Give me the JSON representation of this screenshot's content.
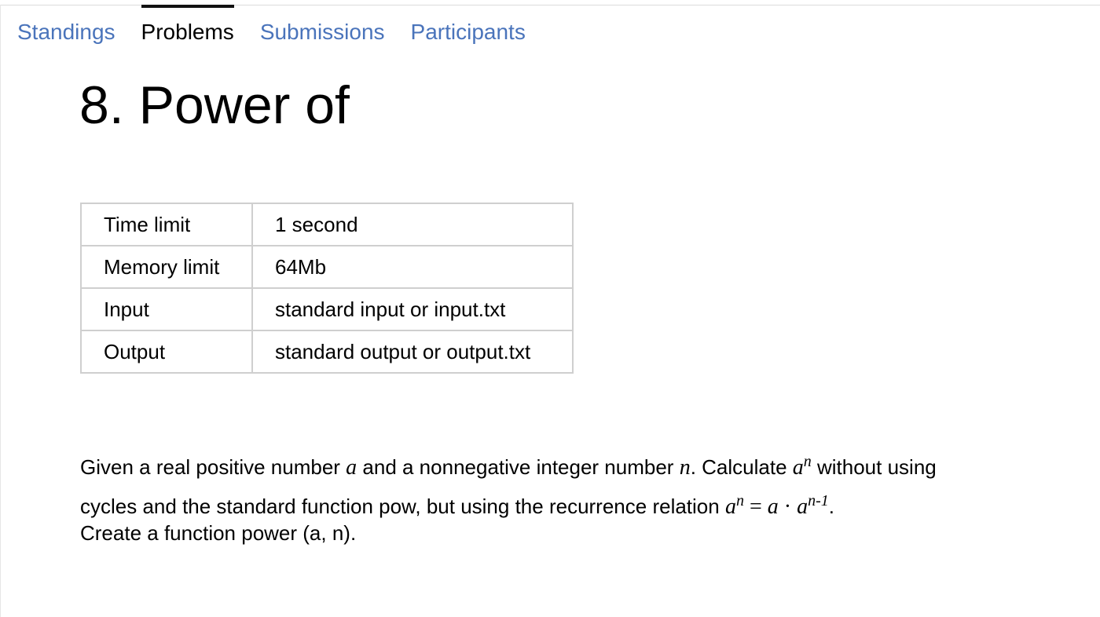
{
  "tabs": [
    {
      "label": "Standings",
      "active": false
    },
    {
      "label": "Problems",
      "active": true
    },
    {
      "label": "Submissions",
      "active": false
    },
    {
      "label": "Participants",
      "active": false
    }
  ],
  "problem": {
    "title": "8. Power of",
    "limits": [
      {
        "key": "Time limit",
        "value": "1 second"
      },
      {
        "key": "Memory limit",
        "value": "64Mb"
      },
      {
        "key": "Input",
        "value": "standard input or input.txt"
      },
      {
        "key": "Output",
        "value": "standard output or output.txt"
      }
    ],
    "statement": {
      "t1": "Given a real positive number ",
      "var_a": "a",
      "t2": " and a nonnegative integer number ",
      "var_n": "n",
      "t3": ". Calculate ",
      "t4": " without using",
      "t5": "cycles and the standard function pow, but using the recurrence relation ",
      "eq": "=",
      "dot": "·",
      "exp_n_minus_1": "n-1",
      "t6": ".",
      "t7": "Create a function power (a, n)."
    }
  }
}
